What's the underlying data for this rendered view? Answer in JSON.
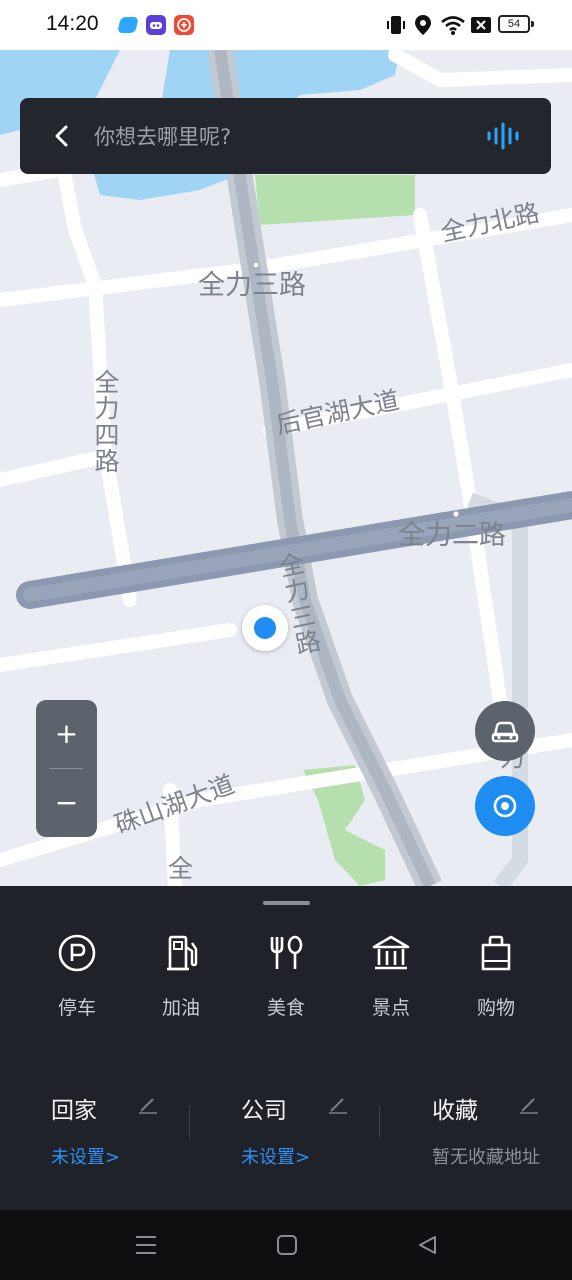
{
  "status_bar": {
    "time": "14:20",
    "battery": "54",
    "icons": [
      "app-icon-blue",
      "app-icon-robot",
      "app-icon-red",
      "vibrate-icon",
      "location-pin-icon",
      "wifi-icon",
      "signal-off-icon",
      "battery-icon"
    ]
  },
  "search": {
    "placeholder": "你想去哪里呢?",
    "back_icon": "back-chevron-icon",
    "voice_icon": "voice-wave-icon",
    "accent_color": "#29a5f5"
  },
  "map": {
    "road_labels": {
      "quanli_north": "全力北路",
      "quanli_three": "全力三路",
      "quanli_four": "全力四路",
      "houguanhu": "后官湖大道",
      "quanli_two": "全力二路",
      "quanli_three_v": "全力三路",
      "zhushanhu": "硃山湖大道",
      "quan_partial": "全",
      "li_partial": "力"
    },
    "location_color": "#1e8cf0",
    "zoom_in": "+",
    "zoom_out": "−"
  },
  "panel": {
    "categories": [
      {
        "label": "停车",
        "icon": "parking-icon"
      },
      {
        "label": "加油",
        "icon": "fuel-icon"
      },
      {
        "label": "美食",
        "icon": "food-icon"
      },
      {
        "label": "景点",
        "icon": "scenic-icon"
      },
      {
        "label": "购物",
        "icon": "shopping-bag-icon"
      }
    ],
    "favorites": [
      {
        "title": "回家",
        "sub": "未设置>"
      },
      {
        "title": "公司",
        "sub": "未设置>"
      },
      {
        "title": "收藏",
        "sub": "暂无收藏地址"
      }
    ],
    "link_color": "#2d8ff0"
  },
  "nav": {
    "icons": [
      "menu-icon",
      "home-icon",
      "back-icon"
    ]
  }
}
